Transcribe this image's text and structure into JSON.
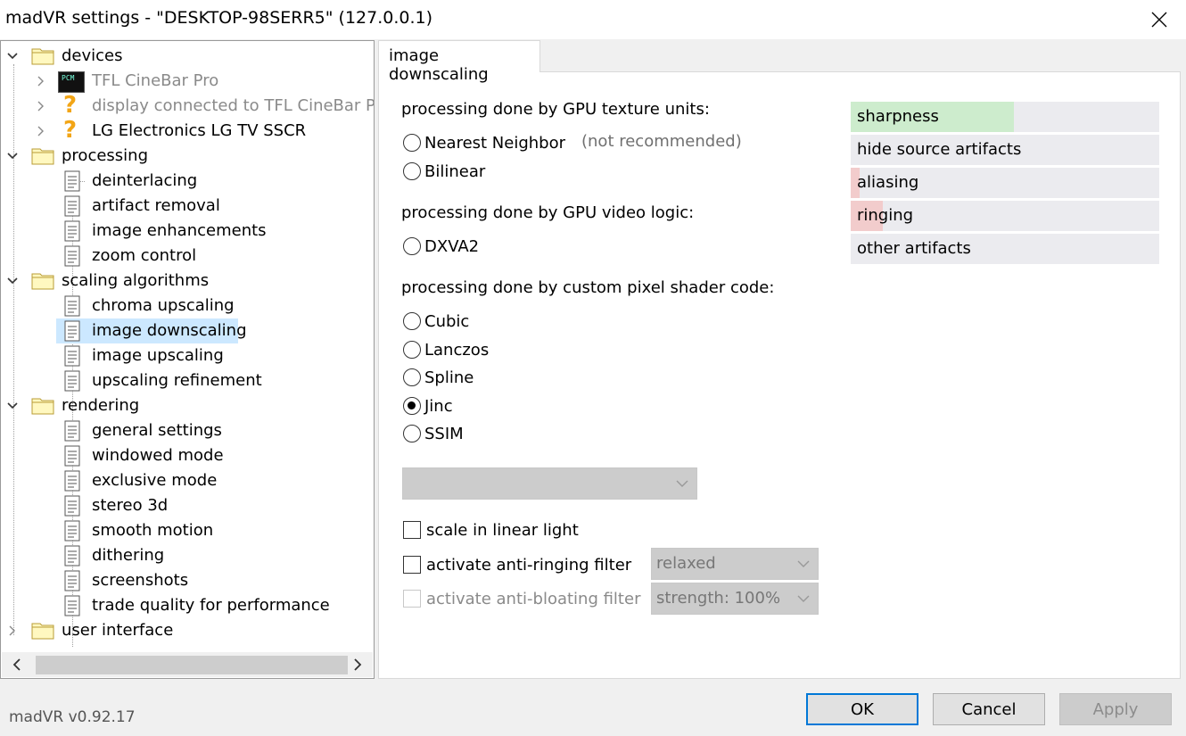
{
  "window": {
    "title": "madVR settings - \"DESKTOP-98SERR5\" (127.0.0.1)"
  },
  "tree": {
    "devices": "devices",
    "tfl_cinebar": "TFL CineBar Pro",
    "display_connected": "display connected to TFL CineBar Pro",
    "lg_tv": "LG Electronics LG TV SSCR",
    "processing": "processing",
    "deinterlacing": "deinterlacing",
    "artifact_removal": "artifact removal",
    "image_enhancements": "image enhancements",
    "zoom_control": "zoom control",
    "scaling_algorithms": "scaling algorithms",
    "chroma_upscaling": "chroma upscaling",
    "image_downscaling": "image downscaling",
    "image_upscaling": "image upscaling",
    "upscaling_refinement": "upscaling refinement",
    "rendering": "rendering",
    "general_settings": "general settings",
    "windowed_mode": "windowed mode",
    "exclusive_mode": "exclusive mode",
    "stereo_3d": "stereo 3d",
    "smooth_motion": "smooth motion",
    "dithering": "dithering",
    "screenshots": "screenshots",
    "trade_quality": "trade quality for performance",
    "user_interface": "user interface",
    "pcm_badge": "PCM"
  },
  "tab": {
    "label": "image downscaling"
  },
  "sections": {
    "gpu_texture": "processing done by GPU texture units:",
    "gpu_video": "processing done by GPU video logic:",
    "pixel_shader": "processing done by custom pixel shader code:"
  },
  "options": {
    "nearest": "Nearest Neighbor",
    "not_recommended": "(not recommended)",
    "bilinear": "Bilinear",
    "dxva2": "DXVA2",
    "cubic": "Cubic",
    "lanczos": "Lanczos",
    "spline": "Spline",
    "jinc": "Jinc",
    "ssim": "SSIM"
  },
  "quality_bars": [
    {
      "label": "sharpness",
      "fill": 0.53,
      "color": "#cdeccd"
    },
    {
      "label": "hide source artifacts",
      "fill": 0.0,
      "color": "#cdeccd"
    },
    {
      "label": "aliasing",
      "fill": 0.03,
      "color": "#f2cccc"
    },
    {
      "label": "ringing",
      "fill": 0.105,
      "color": "#f2cccc"
    },
    {
      "label": "other artifacts",
      "fill": 0.0,
      "color": "#cdeccd"
    }
  ],
  "checkboxes": {
    "linear_light": "scale in linear light",
    "anti_ringing": "activate anti-ringing filter",
    "anti_bloating": "activate anti-bloating filter"
  },
  "dropdowns": {
    "filter_taps": "",
    "anti_ringing_mode": "relaxed",
    "anti_bloating_strength": "strength: 100%"
  },
  "footer": {
    "version": "madVR v0.92.17",
    "ok": "OK",
    "cancel": "Cancel",
    "apply": "Apply"
  }
}
